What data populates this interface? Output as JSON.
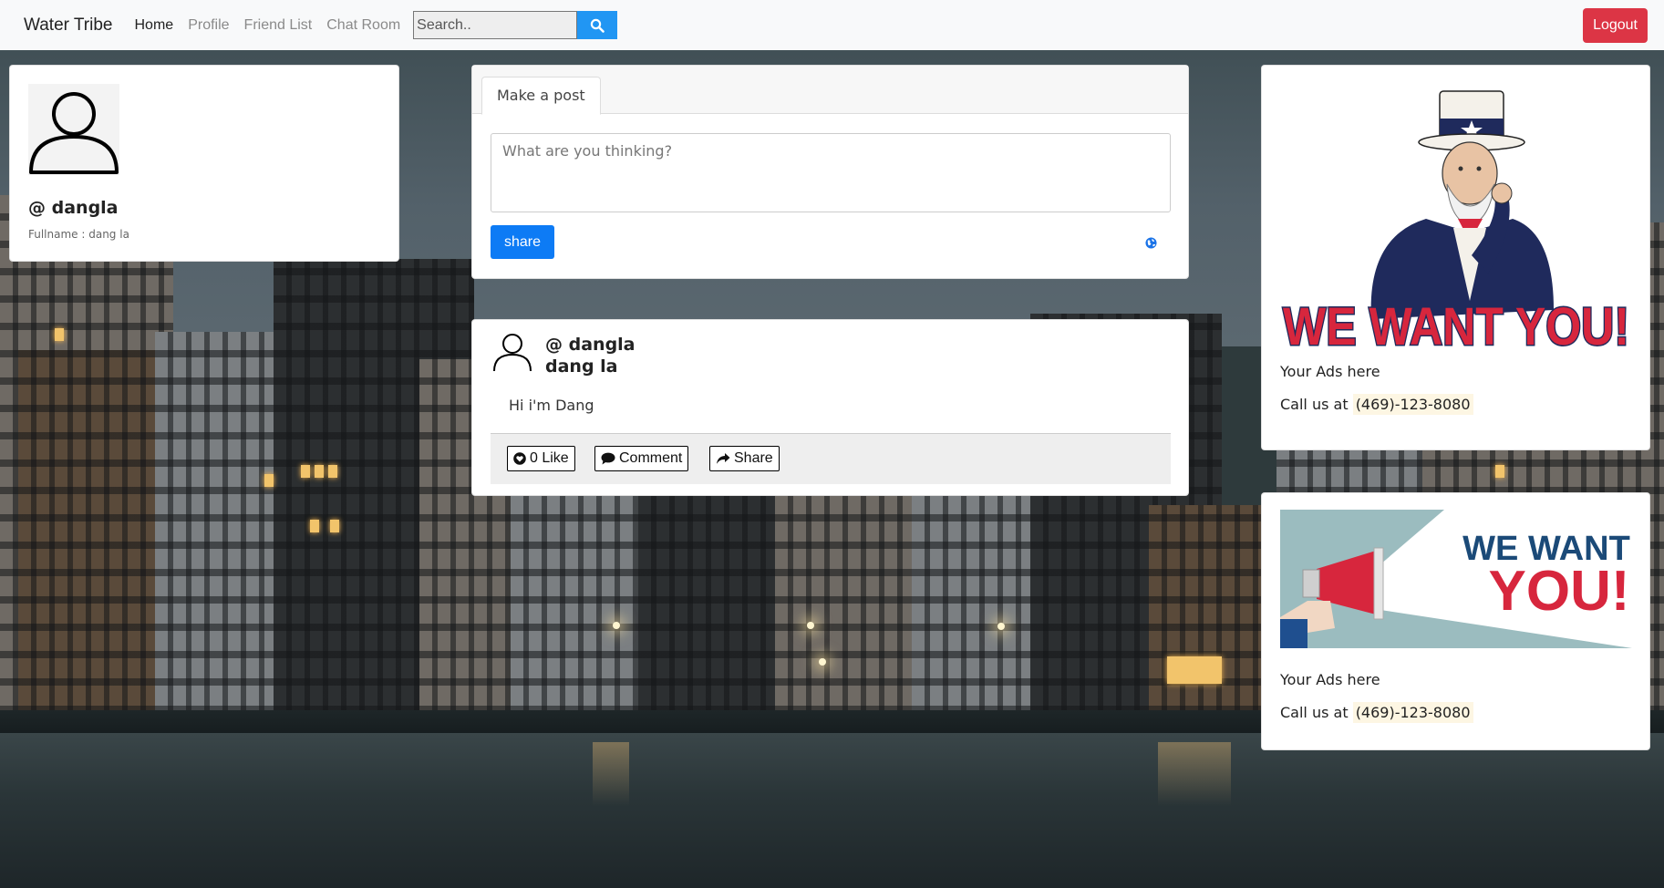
{
  "navbar": {
    "brand": "Water Tribe",
    "links": [
      {
        "label": "Home",
        "active": true
      },
      {
        "label": "Profile",
        "active": false
      },
      {
        "label": "Friend List",
        "active": false
      },
      {
        "label": "Chat Room",
        "active": false
      }
    ],
    "search_placeholder": "Search..",
    "search_icon": "search-icon",
    "logout_label": "Logout"
  },
  "profile": {
    "handle": "@ dangla",
    "fullname": "Fullname : dang la",
    "avatar_icon": "user-avatar-icon"
  },
  "composer": {
    "tab_label": "Make a post",
    "placeholder": "What are you thinking?",
    "share_label": "share",
    "visibility_icon": "globe-icon"
  },
  "feed": {
    "posts": [
      {
        "handle": "@ dangla",
        "name": "dang la",
        "text": "Hi i'm Dang",
        "like_label": "0 Like",
        "comment_label": "Comment",
        "share_label": "Share"
      }
    ]
  },
  "ads": [
    {
      "headline": "WE WANT YOU!",
      "text": "Your Ads here",
      "call_prefix": "Call us at",
      "phone": "(469)-123-8080"
    },
    {
      "headline_top": "WE WANT",
      "headline_bottom": "YOU!",
      "text": "Your Ads here",
      "call_prefix": "Call us at",
      "phone": "(469)-123-8080"
    }
  ],
  "colors": {
    "navbar_bg": "#f8f9fa",
    "search_button": "#2196f3",
    "logout_button": "#dc3545",
    "share_button": "#0d7bf5",
    "poster_red": "#d7263d",
    "poster_navy": "#1f2a5c",
    "phone_highlight": "#fdf6e3"
  }
}
